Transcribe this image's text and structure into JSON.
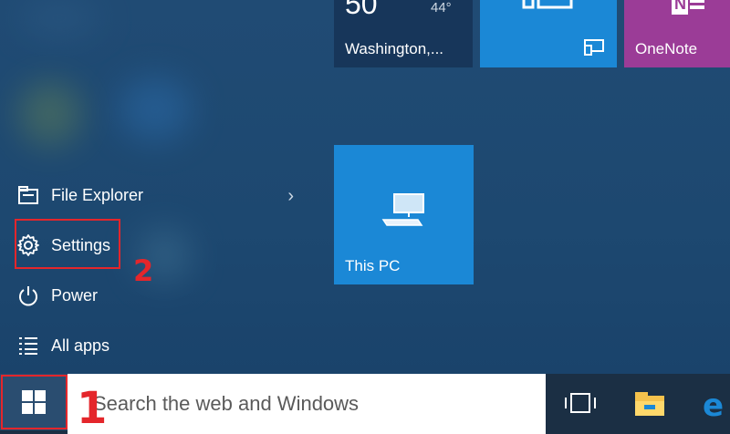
{
  "tiles": {
    "weather": {
      "temp": "50",
      "low": "44°",
      "city": "Washington,..."
    },
    "tablet": {
      "icon": "tablet-mode-icon"
    },
    "onenote": {
      "label": "OneNote"
    },
    "this_pc": {
      "label": "This PC"
    }
  },
  "left_menu": {
    "file_explorer": "File Explorer",
    "settings": "Settings",
    "power": "Power",
    "all_apps": "All apps"
  },
  "annotations": {
    "step1": "1",
    "step2": "2"
  },
  "taskbar": {
    "search_text": "Search the web and Windows"
  },
  "colors": {
    "accent": "#1b88d6",
    "annotation": "#e4262b",
    "onenote": "#9b3c97"
  }
}
